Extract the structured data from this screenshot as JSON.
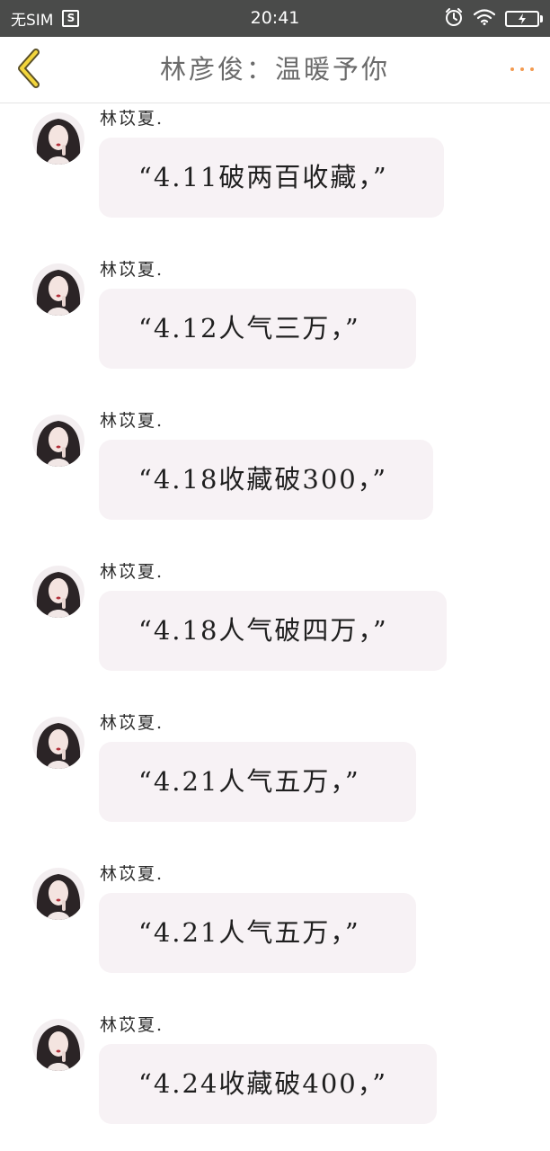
{
  "status_bar": {
    "carrier": "无SIM",
    "sim_badge": "S",
    "time": "20:41"
  },
  "nav": {
    "title": "林彦俊：温暖予你",
    "back_icon": "chevron-left-icon",
    "more_icon": "more-dots-icon",
    "accent_color": "#f39a4f"
  },
  "messages": [
    {
      "sender": "林苡夏.",
      "text": "“4.11破两百收藏，”"
    },
    {
      "sender": "林苡夏.",
      "text": "“4.12人气三万，”"
    },
    {
      "sender": "林苡夏.",
      "text": "“4.18收藏破300，”"
    },
    {
      "sender": "林苡夏.",
      "text": "“4.18人气破四万，”"
    },
    {
      "sender": "林苡夏.",
      "text": "“4.21人气五万，”"
    },
    {
      "sender": "林苡夏.",
      "text": "“4.21人气五万，”"
    },
    {
      "sender": "林苡夏.",
      "text": "“4.24收藏破400，”"
    }
  ],
  "colors": {
    "status_bar_bg": "#4a4b4a",
    "bubble_bg": "#f7f2f5"
  }
}
